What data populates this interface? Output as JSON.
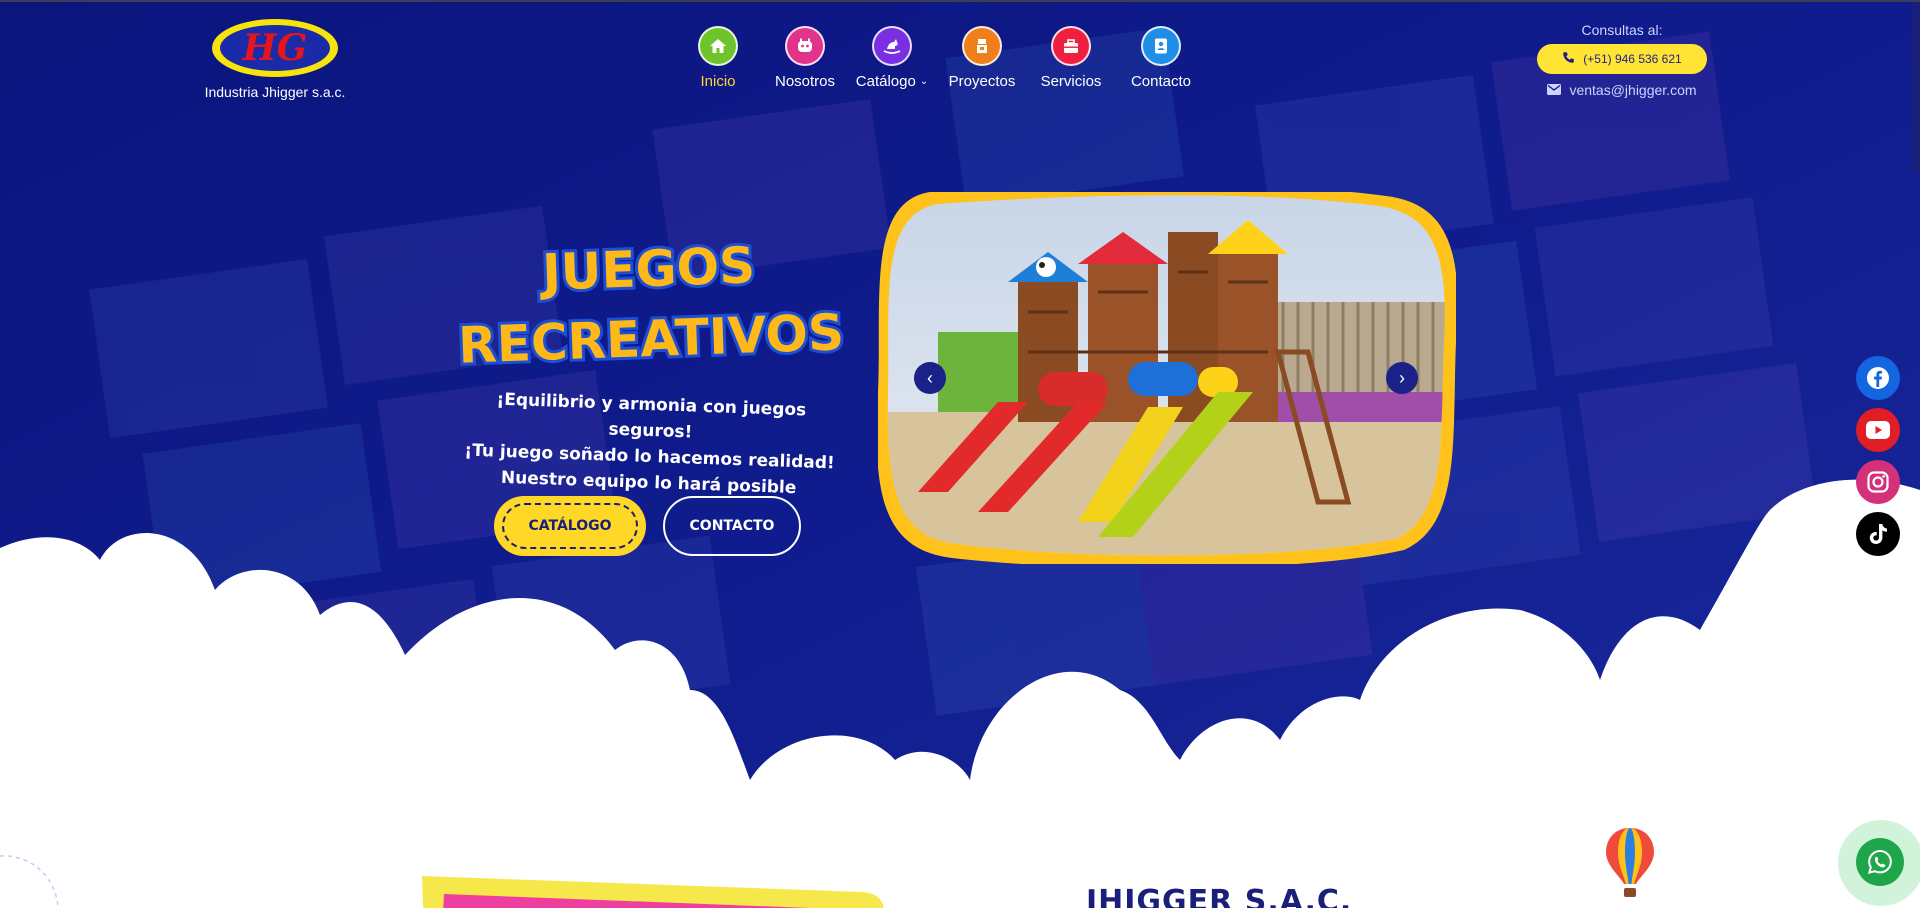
{
  "colors": {
    "hero_background": "#0c1a8a",
    "accent_yellow": "#ffd726",
    "nav_active": "#ffd52a",
    "text_dark_blue": "#1a1f7a"
  },
  "brand": {
    "logo_letters": "HG",
    "company_name": "Industria Jhigger s.a.c."
  },
  "nav": {
    "items": [
      {
        "label": "Inicio",
        "icon": "home-icon",
        "color": "#6fc42b",
        "active": true
      },
      {
        "label": "Nosotros",
        "icon": "robot-face-icon",
        "color": "#e0338b",
        "active": false
      },
      {
        "label": "Catálogo",
        "icon": "rocking-horse-icon",
        "color": "#7a2fe0",
        "active": false,
        "dropdown": true
      },
      {
        "label": "Proyectos",
        "icon": "slide-icon",
        "color": "#ef7f1a",
        "active": false
      },
      {
        "label": "Servicios",
        "icon": "toolbox-icon",
        "color": "#ee1f3f",
        "active": false
      },
      {
        "label": "Contacto",
        "icon": "contact-card-icon",
        "color": "#1e8ee6",
        "active": false
      }
    ]
  },
  "contact": {
    "title": "Consultas al:",
    "phone": "(+51) 946 536 621",
    "email": "ventas@jhigger.com"
  },
  "hero": {
    "title_line1": "JUEGOS",
    "title_line2": "RECREATIVOS",
    "tagline": [
      "¡Equilibrio y armonia con juegos seguros!",
      "¡Tu juego soñado lo hacemos realidad!",
      "Nuestro equipo lo hará posible"
    ],
    "primary_button": "CATÁLOGO",
    "secondary_button": "CONTACTO"
  },
  "slider": {
    "prev_icon": "chevron-left-icon",
    "next_icon": "chevron-right-icon"
  },
  "social": [
    {
      "name": "facebook-icon",
      "color": "#1565e0"
    },
    {
      "name": "youtube-icon",
      "color": "#e11d26"
    },
    {
      "name": "instagram-icon",
      "color": "#d5307a"
    },
    {
      "name": "tiktok-icon",
      "color": "#000000"
    }
  ],
  "whatsapp": {
    "icon": "whatsapp-icon",
    "color": "#1fa64a"
  },
  "about": {
    "heading": "JHIGGER S.A.C."
  }
}
